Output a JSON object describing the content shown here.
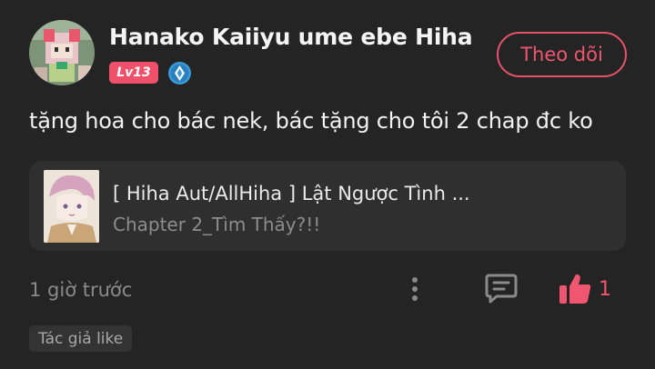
{
  "comment": {
    "user": {
      "name": "Hanako Kaiiyu ume ebe Hiha",
      "level": "Lv13",
      "avatar_icon": "pixel-character-avatar",
      "rank_icon": "diamond-rank-icon"
    },
    "follow_label": "Theo dõi",
    "text": "tặng hoa cho bác nek, bác tặng cho tôi 2 chap đc ko",
    "chapter_card": {
      "title": "[ Hiha Aut/AllHiha ] Lật Ngược Tình ...",
      "subtitle": "Chapter 2_Tìm Thấy?!!"
    },
    "timestamp": "1 giờ trước",
    "like_count": "1",
    "author_tag": "Tác giả like"
  },
  "colors": {
    "background": "#242424",
    "card": "#2f2f2f",
    "accent": "#f0566f",
    "level_badge": "#f0506a",
    "rank_badge": "#3a9bd9",
    "muted_text": "#8a8a8a"
  }
}
